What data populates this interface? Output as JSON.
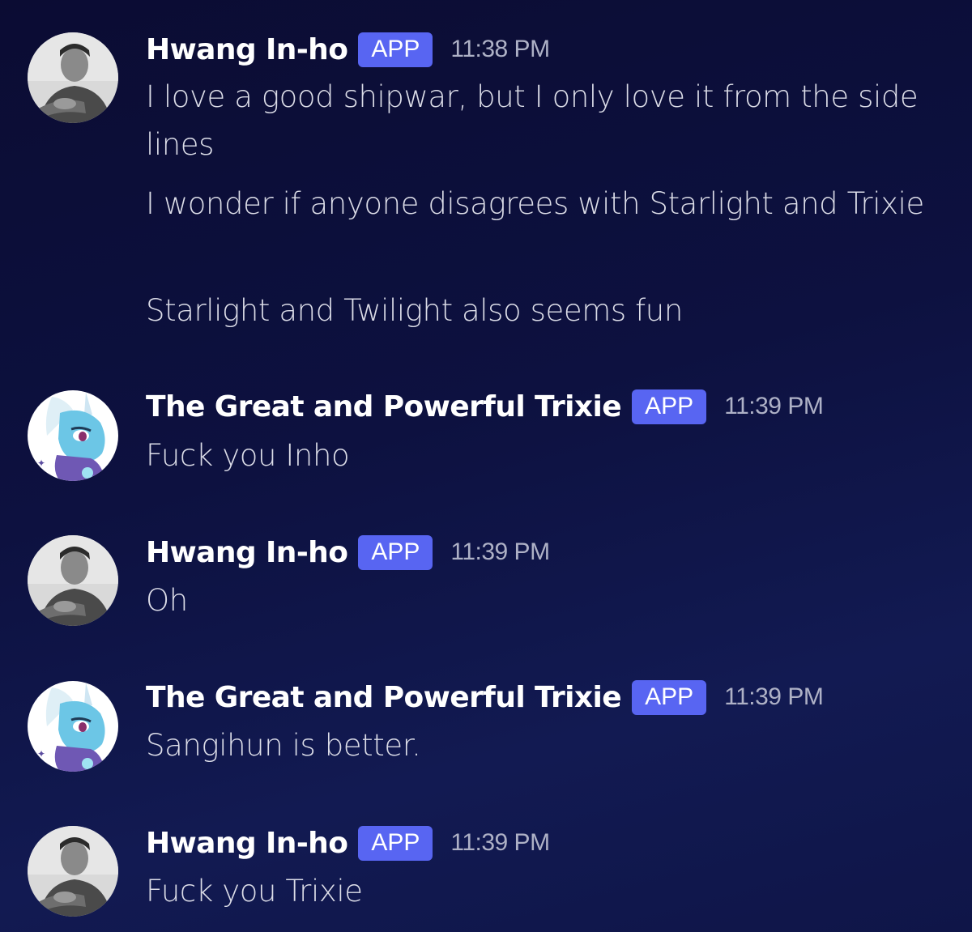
{
  "messages": [
    {
      "author": "Hwang In-ho",
      "badge": "APP",
      "time": "11:38 PM",
      "avatar_icon": "person-photo-avatar",
      "lines": [
        "I love a good shipwar, but I only love it from the side lines",
        "I wonder if anyone disagrees with Starlight and Trixie",
        "Starlight and Twilight also seems fun"
      ]
    },
    {
      "author": "The Great and Powerful Trixie",
      "badge": "APP",
      "time": "11:39 PM",
      "avatar_icon": "unicorn-pony-avatar",
      "lines": [
        "Fuck you Inho"
      ]
    },
    {
      "author": "Hwang In-ho",
      "badge": "APP",
      "time": "11:39 PM",
      "avatar_icon": "person-photo-avatar",
      "lines": [
        "Oh"
      ]
    },
    {
      "author": "The Great and Powerful Trixie",
      "badge": "APP",
      "time": "11:39 PM",
      "avatar_icon": "unicorn-pony-avatar",
      "lines": [
        "Sangihun is better."
      ]
    },
    {
      "author": "Hwang In-ho",
      "badge": "APP",
      "time": "11:39 PM",
      "avatar_icon": "person-photo-avatar",
      "lines": [
        "Fuck you Trixie"
      ]
    }
  ],
  "colors": {
    "background": "#0d1140",
    "badge": "#5865f2",
    "username": "#ffffff",
    "timestamp": "#aeb1c6",
    "message_text": "#dcdde8"
  }
}
